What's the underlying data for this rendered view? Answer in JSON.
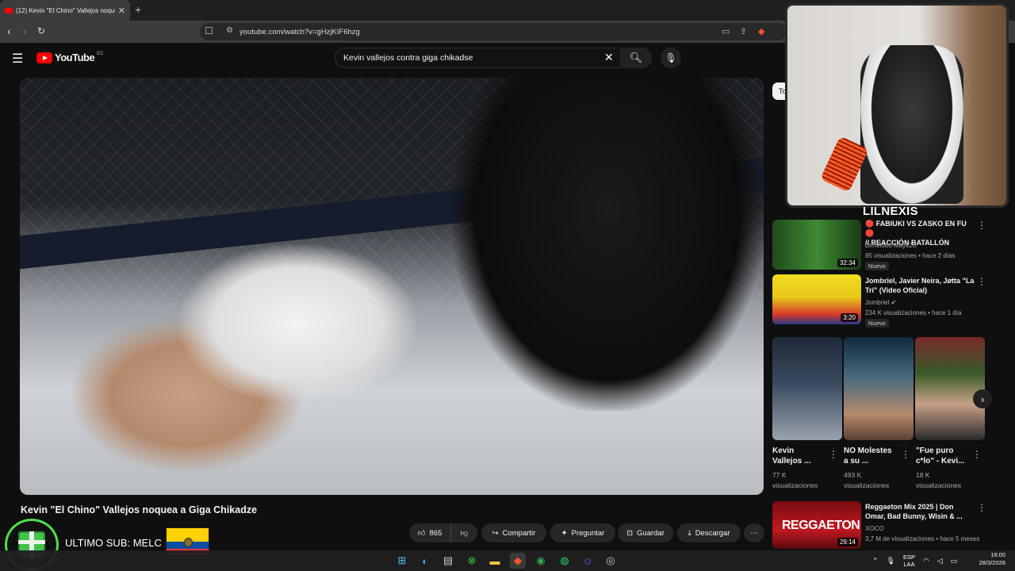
{
  "browser": {
    "tab_title": "(12) Kevin \"El Chino\" Vallejos noquea",
    "new_tab": "+",
    "url": "youtube.com/watch?v=gHzjKIF6hzg"
  },
  "youtube": {
    "logo_text": "YouTube",
    "country": "EC",
    "search_value": "Kevin vallejos contra giga chikadse"
  },
  "video": {
    "title": "Kevin \"El Chino\" Vallejos noquea a Giga Chikadze",
    "likes": "865",
    "actions": {
      "share": "Compartir",
      "ask": "Preguntar",
      "save": "Guardar",
      "download": "Descargar",
      "more": "⋯"
    }
  },
  "recommendations": {
    "chip": "To",
    "items": [
      {
        "title_1": "🔴 FABIUKI VS ZASKO EN FU 🔴",
        "title_2": "// REACCIÓN BATALLÓN",
        "channel": "Dimelooo Mayk26",
        "meta": "85 visualizaciones • hace 2 días",
        "badge": "Nuevo",
        "duration": "32:34",
        "thumb_color": "#2f6b2a"
      },
      {
        "title_1": "Jombriel, Javier Neira, Jøtta \"La",
        "title_2": "Tri\" (Video Oficial)",
        "channel": "Jombriel",
        "meta": "234 K visualizaciones • hace 1 día",
        "badge": "Nuevo",
        "duration": "3:20",
        "thumb_color": "#e8d21a"
      },
      {
        "title_1": "Reggaeton Mix 2025 | Don",
        "title_2": "Omar, Bad Bunny, Wisin & ...",
        "channel": "XOCO",
        "meta": "3,7 M de visualizaciones • hace 5 meses",
        "duration": "29:14",
        "thumb_text": "REGGAETON",
        "thumb_color": "#b3121a"
      }
    ],
    "shorts": [
      {
        "title_1": "Kevin",
        "title_2": "Vallejos ...",
        "views_1": "77 K",
        "views_2": "visualizaciones"
      },
      {
        "title_1": "NO Molestes",
        "title_2": "a su ...",
        "views_1": "493 K",
        "views_2": "visualizaciones"
      },
      {
        "title_1": "\"Fue puro",
        "title_2": "c*lo\" - Kevi...",
        "views_1": "18 K",
        "views_2": "visualizaciones"
      }
    ]
  },
  "overlay": {
    "streamer": "LILNEXIS",
    "sub_text": "ULTIMO SUB: MELC"
  },
  "taskbar": {
    "lang_1": "ESP",
    "lang_2": "LAA",
    "time": "16:00",
    "date": "28/3/2026"
  },
  "colors": {
    "accent_red": "#ff0000",
    "sub_green": "#4ee04e"
  }
}
